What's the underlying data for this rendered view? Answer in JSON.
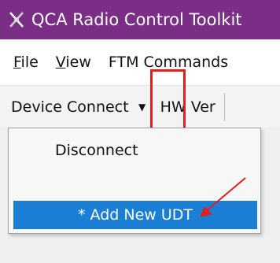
{
  "window": {
    "title": "QCA Radio Control Toolkit",
    "title_bar_color": "#7a2e86",
    "icon": "radio-tower-icon"
  },
  "menubar": {
    "items": [
      {
        "label": "File"
      },
      {
        "label": "View"
      },
      {
        "label": "FTM Commands"
      }
    ]
  },
  "toolbar": {
    "device_connect_label": "Device Connect",
    "hw_ver_label": "HW Ver",
    "dropdown_icon": "caret-down-icon"
  },
  "dropdown_menu": {
    "items": [
      {
        "label": "Disconnect",
        "selected": false
      },
      {
        "label": "* Add New UDT",
        "selected": true
      }
    ],
    "selection_color": "#1a7fd4"
  },
  "annotations": {
    "highlight_color": "#e11f1f",
    "arrow_color": "#e11f1f"
  }
}
